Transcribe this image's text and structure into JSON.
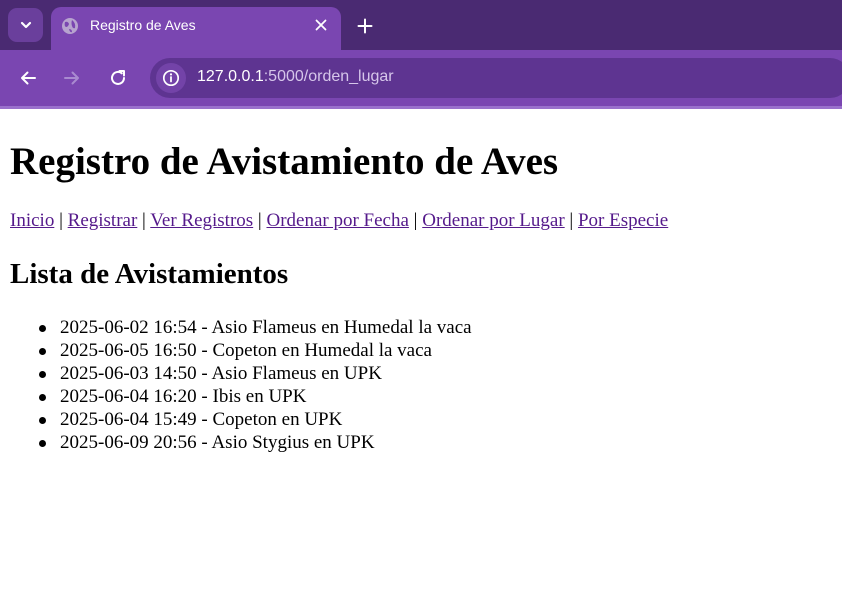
{
  "browser": {
    "tab_title": "Registro de Aves",
    "url_host": "127.0.0.1",
    "url_path": ":5000/orden_lugar",
    "colors": {
      "tabstrip": "#4a2a72",
      "active_tab": "#7a46b1",
      "toolbar": "#7a46b1",
      "link_visited": "#551a8b"
    }
  },
  "page": {
    "heading": "Registro de Avistamiento de Aves",
    "nav": {
      "inicio": "Inicio",
      "registrar": "Registrar",
      "ver_registros": "Ver Registros",
      "ordenar_fecha": "Ordenar por Fecha",
      "ordenar_lugar": "Ordenar por Lugar",
      "por_especie": "Por Especie",
      "separator": " | "
    },
    "list_heading": "Lista de Avistamientos",
    "sightings": [
      "2025-06-02 16:54 - Asio Flameus en Humedal la vaca",
      "2025-06-05 16:50 - Copeton en Humedal la vaca",
      "2025-06-03 14:50 - Asio Flameus en UPK",
      "2025-06-04 16:20 - Ibis en UPK",
      "2025-06-04 15:49 - Copeton en UPK",
      "2025-06-09 20:56 - Asio Stygius en UPK"
    ]
  }
}
